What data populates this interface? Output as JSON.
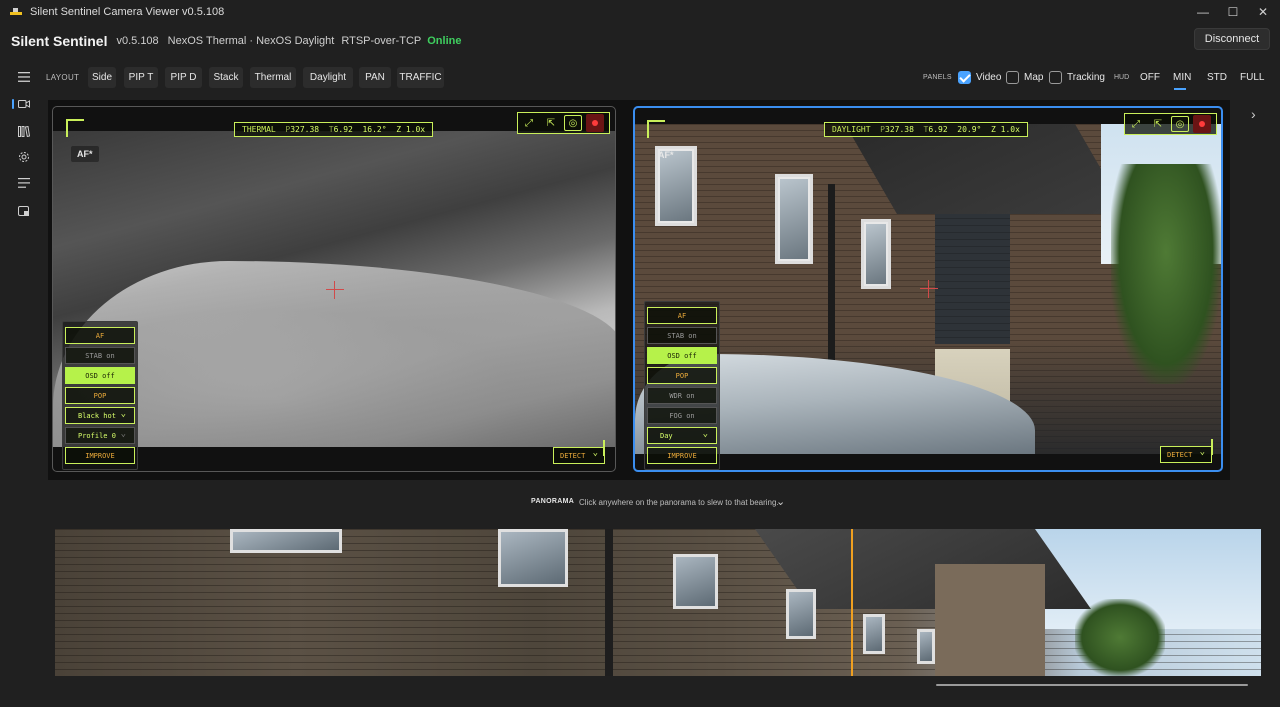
{
  "window": {
    "title": "Silent Sentinel Camera Viewer v0.5.108",
    "controls": [
      "—",
      "☐",
      "✕"
    ]
  },
  "app": {
    "brand": "Silent Sentinel",
    "version": "v0.5.108",
    "device": "NexOS Thermal · NexOS Daylight",
    "protocol": "RTSP-over-TCP",
    "status": "Online",
    "status_color": "#3fcf5f",
    "disconnect_label": "Disconnect"
  },
  "rail": {
    "icons": [
      "menu-icon",
      "video-camera-icon",
      "library-icon",
      "settings-gear-icon",
      "list-icon",
      "device-icon"
    ],
    "active": "video-camera-icon"
  },
  "toolbar": {
    "layout_label": "LAYOUT",
    "layouts": [
      "Side",
      "PIP T",
      "PIP D",
      "Stack",
      "Thermal",
      "Daylight",
      "PAN",
      "TRAFFIC"
    ],
    "panels_label": "PANELS",
    "panels": [
      {
        "label": "Video",
        "checked": true
      },
      {
        "label": "Map",
        "checked": false
      },
      {
        "label": "Tracking",
        "checked": false
      }
    ],
    "hud_label": "HUD",
    "hud_options": [
      "OFF",
      "MIN",
      "STD",
      "FULL"
    ],
    "hud_selected": "MIN",
    "accent": "#4aa3ff"
  },
  "thermal": {
    "osd_name": "THERMAL",
    "osd_p_key": "P",
    "osd_p": "327.38",
    "osd_t_key": "T",
    "osd_t": "6.92",
    "osd_fov": "16.2°",
    "osd_z_key": "Z",
    "osd_z": "1.0x",
    "af_tag": "AF*",
    "buttons": {
      "af": "AF",
      "stab": "STAB on",
      "osd": "OSD off",
      "pop": "POP",
      "palette": "Black hot",
      "profile": "Profile 0",
      "improve": "IMPROVE"
    },
    "detect": "DETECT"
  },
  "daylight": {
    "osd_name": "DAYLIGHT",
    "osd_p_key": "P",
    "osd_p": "327.38",
    "osd_t_key": "T",
    "osd_t": "6.92",
    "osd_fov": "20.9°",
    "osd_z_key": "Z",
    "osd_z": "1.0x",
    "af_tag": "AF*",
    "buttons": {
      "af": "AF",
      "stab": "STAB on",
      "osd": "OSD off",
      "pop": "POP",
      "wdr": "WDR on",
      "fog": "FOG on",
      "mode": "Day",
      "improve": "IMPROVE"
    },
    "detect": "DETECT"
  },
  "osd_color": "#c9ef5a",
  "panorama": {
    "label": "PANORAMA",
    "hint": "Click anywhere on the panorama to slew to that bearing.",
    "bearing_marker_color": "#f0a020"
  }
}
